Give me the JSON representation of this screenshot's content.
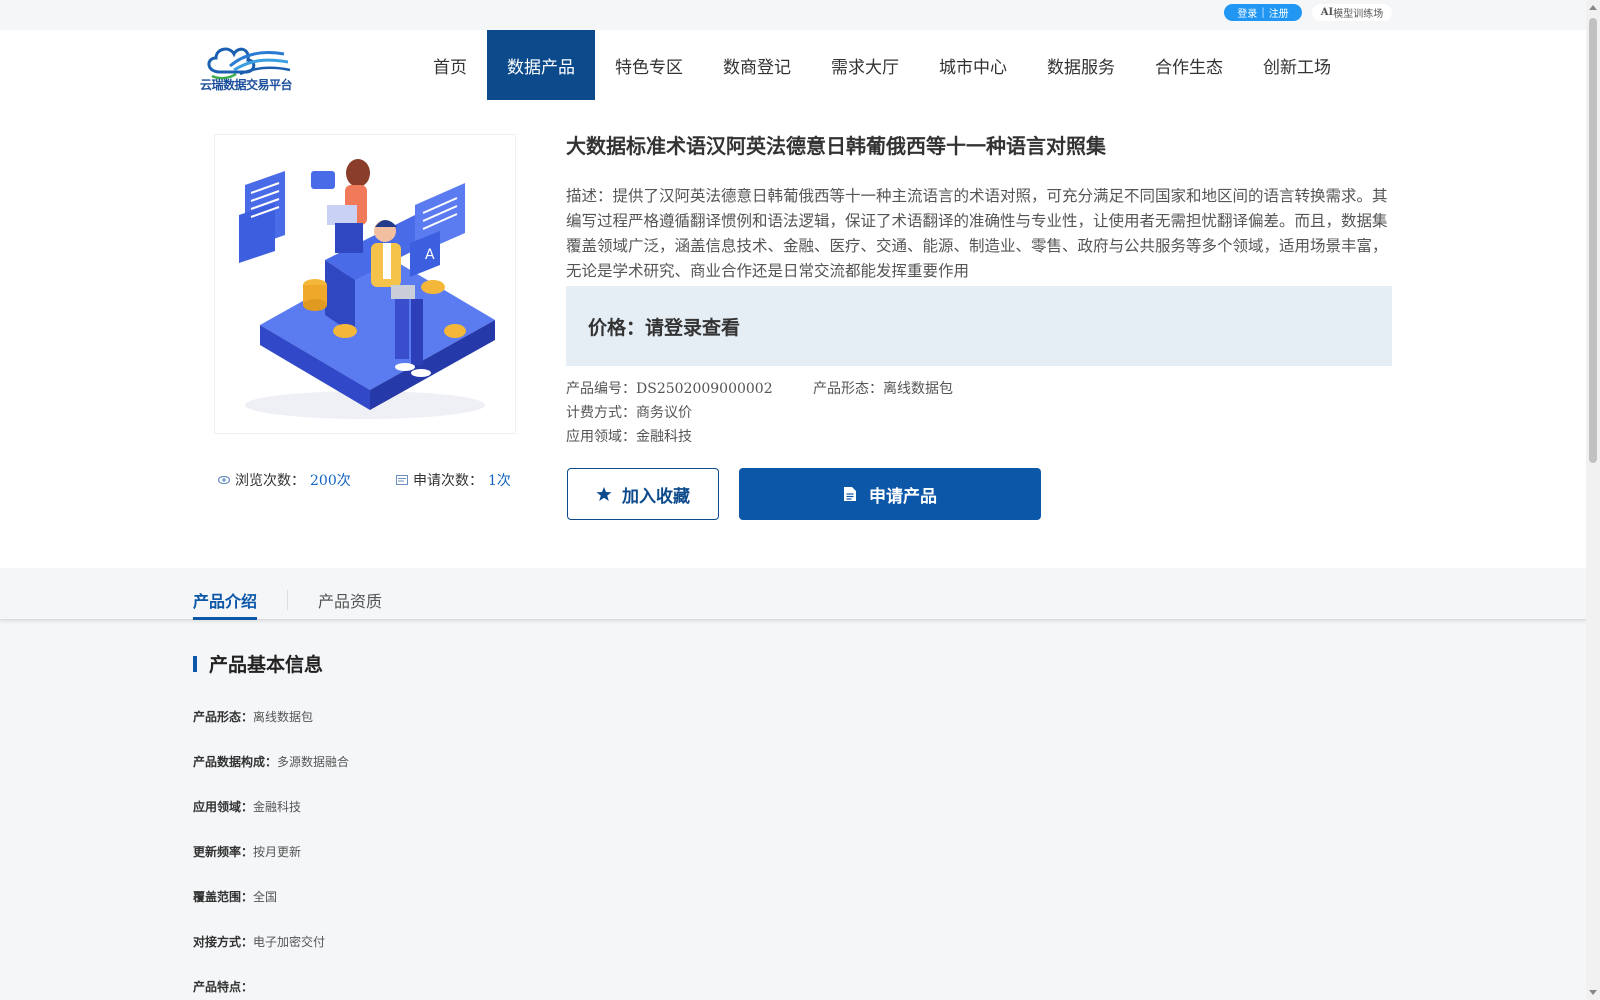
{
  "topbar": {
    "login": "登录",
    "separator": "|",
    "register": "注册",
    "ai_bold": "AI",
    "ai_rest": "模型训练场"
  },
  "header": {
    "logo_text": "云瑞数据交易平台",
    "nav": [
      {
        "label": "首页",
        "active": false
      },
      {
        "label": "数据产品",
        "active": true
      },
      {
        "label": "特色专区",
        "active": false
      },
      {
        "label": "数商登记",
        "active": false
      },
      {
        "label": "需求大厅",
        "active": false
      },
      {
        "label": "城市中心",
        "active": false
      },
      {
        "label": "数据服务",
        "active": false
      },
      {
        "label": "合作生态",
        "active": false
      },
      {
        "label": "创新工场",
        "active": false
      }
    ]
  },
  "product": {
    "title": "大数据标准术语汉阿英法德意日韩葡俄西等十一种语言对照集",
    "description": "描述：提供了汉阿英法德意日韩葡俄西等十一种主流语言的术语对照，可充分满足不同国家和地区间的语言转换需求。其编写过程严格遵循翻译惯例和语法逻辑，保证了术语翻译的准确性与专业性，让使用者无需担忧翻译偏差。而且，数据集覆盖领域广泛，涵盖信息技术、金融、医疗、交通、能源、制造业、零售、政府与公共服务等多个领域，适用场景丰富，无论是学术研究、商业合作还是日常交流都能发挥重要作用",
    "price": "价格：请登录查看",
    "code_label": "产品编号：",
    "code": "DS2502009000002",
    "form_label": "产品形态：",
    "form": "离线数据包",
    "billing_label": "计费方式：",
    "billing": "商务议价",
    "domain_label": "应用领域：",
    "domain": "金融科技",
    "views_label": "浏览次数：",
    "views": "200次",
    "applies_label": "申请次数：",
    "applies": "1次",
    "fav_button": "加入收藏",
    "apply_button": "申请产品"
  },
  "tabs": [
    {
      "label": "产品介绍",
      "active": true
    },
    {
      "label": "产品资质",
      "active": false
    }
  ],
  "basic_info": {
    "title": "产品基本信息",
    "rows": [
      {
        "key": "产品形态：",
        "value": "离线数据包"
      },
      {
        "key": "产品数据构成：",
        "value": "多源数据融合"
      },
      {
        "key": "应用领域：",
        "value": "金融科技"
      },
      {
        "key": "更新频率：",
        "value": "按月更新"
      },
      {
        "key": "覆盖范围：",
        "value": "全国"
      },
      {
        "key": "对接方式：",
        "value": "电子加密交付"
      },
      {
        "key": "产品特点：",
        "value": ""
      }
    ]
  },
  "colors": {
    "brand_blue": "#0c4a8c",
    "button_blue": "#0c57a8",
    "price_bg": "#e4eef4",
    "pill_blue": "#2196f3"
  }
}
